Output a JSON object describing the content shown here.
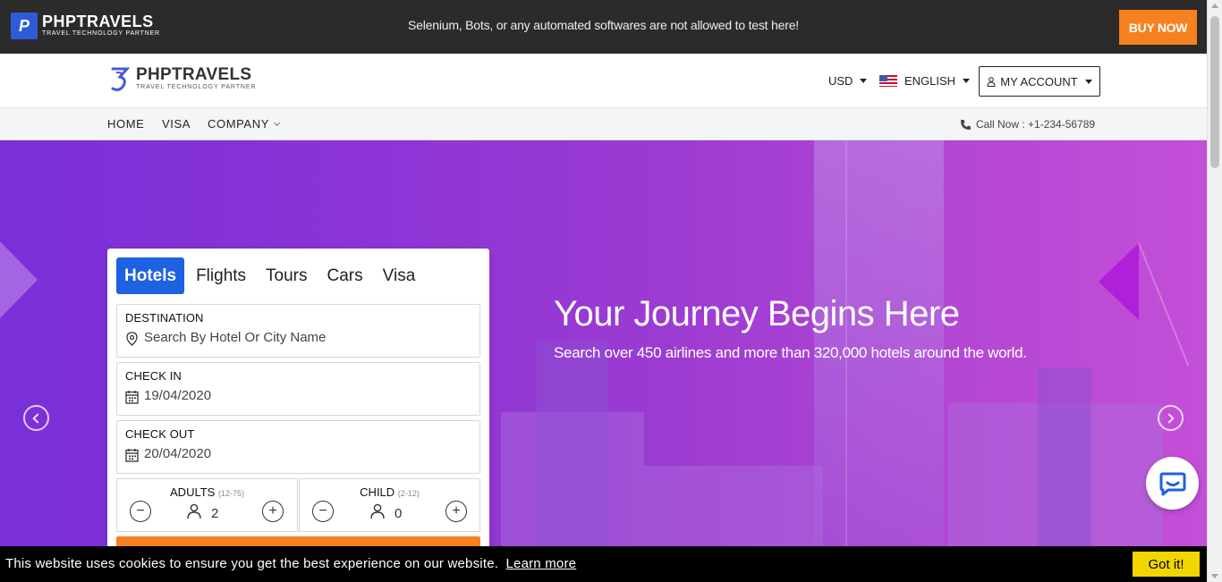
{
  "topbar": {
    "logo_icon": "phptravels-logo-icon",
    "logo_name": "PHPTRAVELS",
    "logo_tagline": "TRAVEL TECHNOLOGY PARTNER",
    "notice": "Selenium, Bots, or any automated softwares are not allowed to test here!",
    "buy_now_label": "BUY NOW",
    "buy_now_color": "#f7801f"
  },
  "header": {
    "logo_name": "PHPTRAVELS",
    "logo_tagline": "TRAVEL TECHNOLOGY PARTNER",
    "currency": "USD",
    "language": "ENGLISH",
    "language_flag_icon": "us-flag-icon",
    "account_label": "MY ACCOUNT"
  },
  "nav": {
    "items": [
      {
        "label": "HOME"
      },
      {
        "label": "VISA"
      },
      {
        "label": "COMPANY"
      }
    ],
    "call_now": "Call Now : +1-234-56789"
  },
  "hero": {
    "title": "Your Journey Begins Here",
    "subtitle": "Search over 450 airlines and more than 320,000 hotels around the world."
  },
  "search": {
    "tabs": [
      {
        "label": "Hotels",
        "active": true
      },
      {
        "label": "Flights",
        "active": false
      },
      {
        "label": "Tours",
        "active": false
      },
      {
        "label": "Cars",
        "active": false
      },
      {
        "label": "Visa",
        "active": false
      }
    ],
    "destination": {
      "label": "DESTINATION",
      "placeholder": "Search By Hotel Or City Name"
    },
    "check_in": {
      "label": "CHECK IN",
      "value": "19/04/2020"
    },
    "check_out": {
      "label": "CHECK OUT",
      "value": "20/04/2020"
    },
    "adults": {
      "label": "ADULTS",
      "range": "(12-75)",
      "value": "2"
    },
    "child": {
      "label": "CHILD",
      "range": "(2-12)",
      "value": "0"
    },
    "minus": "−",
    "plus": "+",
    "active_tab_color": "#1d62e0",
    "search_button_color": "#f7801f"
  },
  "cookie": {
    "message": "This website uses cookies to ensure you get the best experience on our website.",
    "learn_more": "Learn more",
    "got_it": "Got it!"
  }
}
